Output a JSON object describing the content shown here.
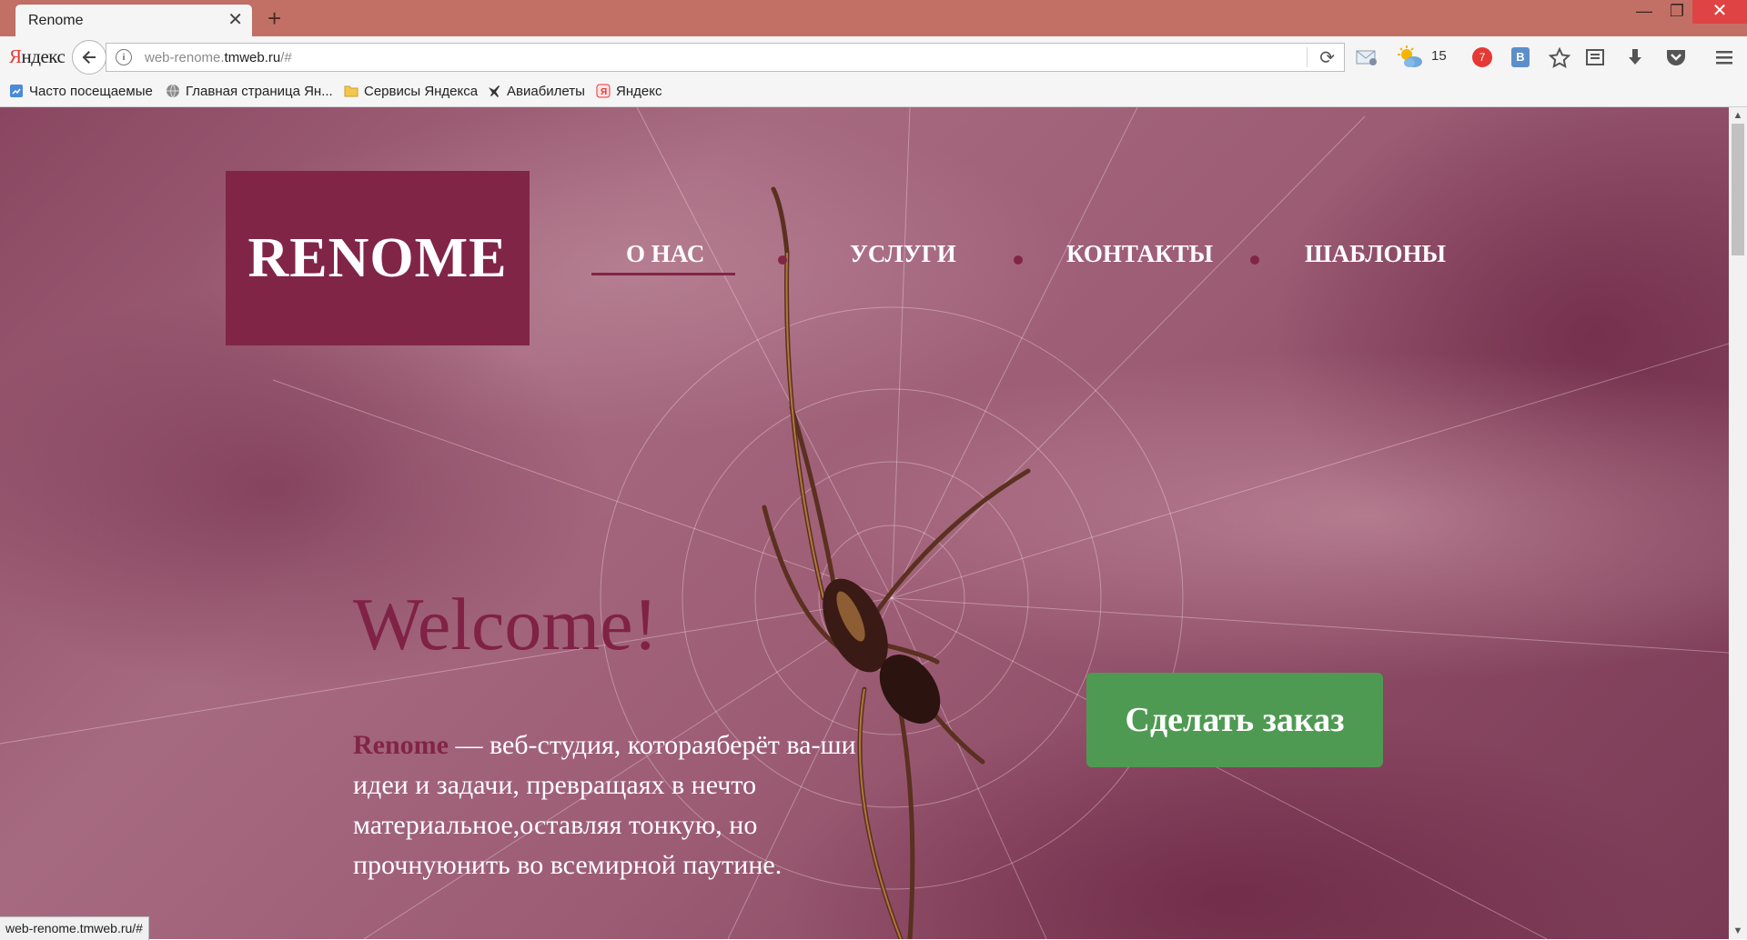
{
  "browser": {
    "tab_title": "Renome",
    "tab_close_glyph": "✕",
    "new_tab_glyph": "+",
    "window_controls": {
      "minimize": "—",
      "maximize": "❐",
      "close": "✕"
    },
    "yandex_logo": {
      "first": "Я",
      "rest": "ндекс"
    },
    "url_prefix": "web-renome.",
    "url_domain": "tmweb.ru",
    "url_suffix": "/#",
    "weather_temp": "15",
    "notification_count": "7",
    "status_url": "web-renome.tmweb.ru/#",
    "bookmarks": [
      {
        "label": "Часто посещаемые",
        "icon": "frequent-icon"
      },
      {
        "label": "Главная страница Ян...",
        "icon": "globe-icon"
      },
      {
        "label": "Сервисы Яндекса",
        "icon": "folder-icon"
      },
      {
        "label": "Авиабилеты",
        "icon": "airplane-icon"
      },
      {
        "label": "Яндекс",
        "icon": "yandex-icon"
      }
    ],
    "toolbar_icons": [
      "mail-icon",
      "weather-icon",
      "notification-icon",
      "extension-icon",
      "bookmark-star-icon",
      "reading-list-icon",
      "download-icon",
      "pocket-icon",
      "menu-icon"
    ],
    "colors": {
      "titlebar": "#c27066",
      "close_button": "#e04343"
    }
  },
  "site": {
    "logo": "RENOME",
    "nav": [
      {
        "label": "О НАС",
        "active": true
      },
      {
        "label": "УСЛУГИ",
        "active": false
      },
      {
        "label": "КОНТАКТЫ",
        "active": false
      },
      {
        "label": "ШАБЛОНЫ",
        "active": false
      }
    ],
    "welcome": "Welcome!",
    "intro_brand": "Renome",
    "intro_text": " — веб-студия, котораяберёт ва-ши идеи и задачи, превращаях в нечто материальное,оставляя тонкую, но прочнуюнить во всемирной паутине.",
    "cta_label": "Сделать заказ",
    "colors": {
      "brand": "#812547",
      "cta": "#4f9a52"
    }
  }
}
